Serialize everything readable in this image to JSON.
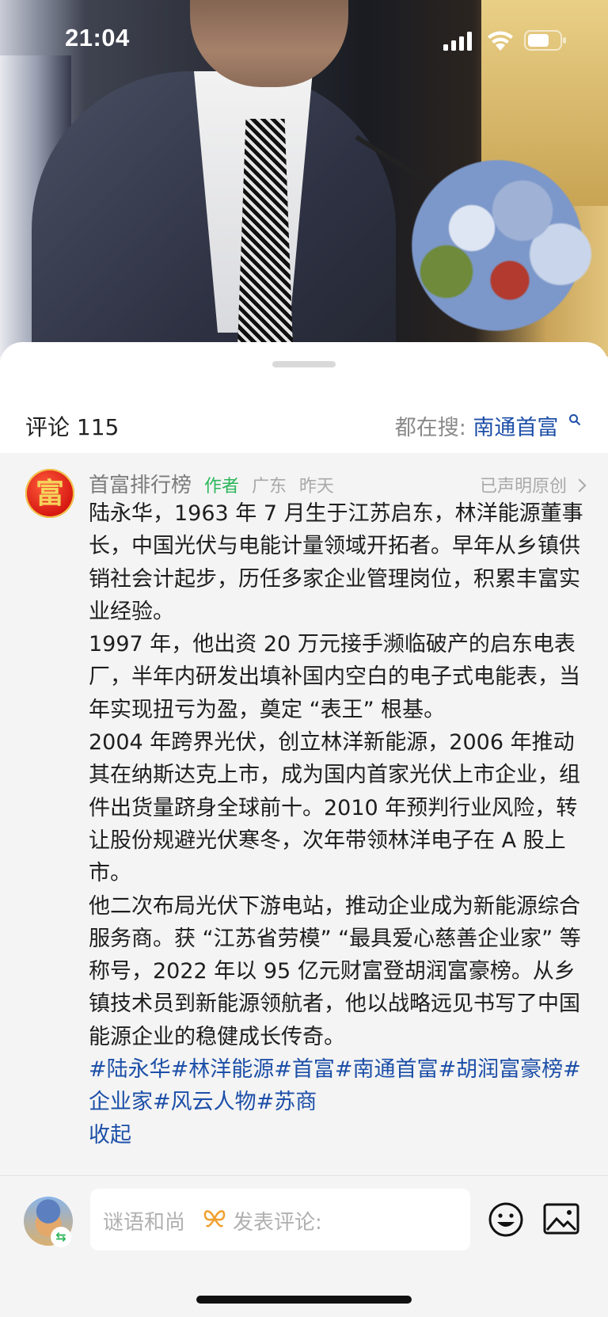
{
  "status_bar": {
    "time": "21:04"
  },
  "comments": {
    "count_label": "评论 115",
    "trending_prefix": "都在搜:",
    "trending_term": "南通首富"
  },
  "comment": {
    "avatar_char": "富",
    "author": "首富排行榜",
    "tag": "作者",
    "location": "广东",
    "time": "昨天",
    "original_label": "已声明原创",
    "paragraphs": [
      "陆永华，1963 年 7 月生于江苏启东，林洋能源董事长，中国光伏与电能计量领域开拓者。早年从乡镇供销社会计起步，历任多家企业管理岗位，积累丰富实业经验。",
      "1997 年，他出资 20 万元接手濒临破产的启东电表厂，半年内研发出填补国内空白的电子式电能表，当年实现扭亏为盈，奠定 “表王” 根基。",
      "2004 年跨界光伏，创立林洋新能源，2006 年推动其在纳斯达克上市，成为国内首家光伏上市企业，组件出货量跻身全球前十。2010 年预判行业风险，转让股份规避光伏寒冬，次年带领林洋电子在 A 股上市。",
      "他二次布局光伏下游电站，推动企业成为新能源综合服务商。获 “江苏省劳模” “最具爱心慈善企业家” 等称号，2022 年以 95 亿元财富登胡润富豪榜。从乡镇技术员到新能源领航者，他以战略远见书写了中国能源企业的稳健成长传奇。"
    ],
    "hashtags": [
      "#陆永华",
      "#林洋能源",
      "#首富",
      "#南通首富",
      "#胡润富豪榜",
      "#企业家",
      "#风云人物",
      "#苏商"
    ],
    "collapse_label": "收起"
  },
  "input_bar": {
    "username": "谜语和尚",
    "placeholder": "发表评论:"
  },
  "colors": {
    "link_blue": "#1d4fa8",
    "author_green": "#2db65b",
    "background": "#f4f4f4"
  },
  "icons": [
    "signal-icon",
    "wifi-icon",
    "battery-icon",
    "search-icon",
    "chevron-right-icon",
    "emoji-icon",
    "image-icon"
  ]
}
